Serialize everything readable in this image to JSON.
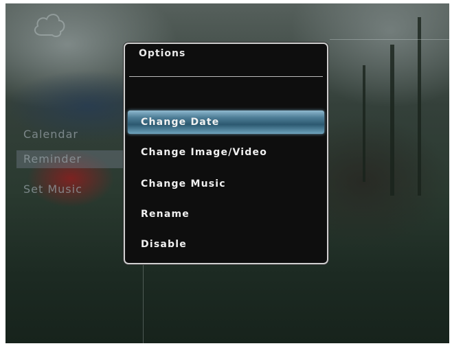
{
  "left_menu": {
    "items": [
      {
        "label": "Calendar"
      },
      {
        "label": "Reminder",
        "selected": true
      },
      {
        "label": "Set Music"
      }
    ]
  },
  "dialog": {
    "title": "Options",
    "options": [
      {
        "label": "Change Date",
        "selected": true
      },
      {
        "label": "Change Image/Video"
      },
      {
        "label": "Change Music"
      },
      {
        "label": "Rename"
      },
      {
        "label": "Disable"
      }
    ]
  },
  "icons": {
    "top_left": "cloud-icon"
  },
  "colors": {
    "highlight": "#3a6a82",
    "dialog_bg": "#0e0e0e"
  }
}
